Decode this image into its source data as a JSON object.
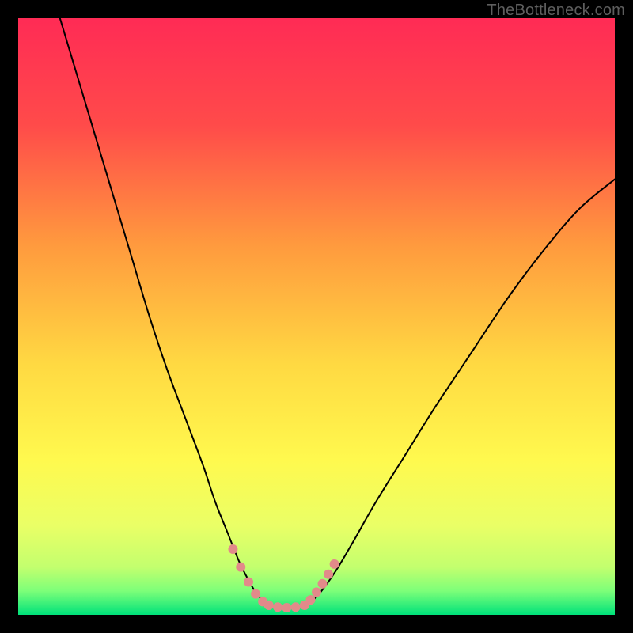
{
  "watermark": "TheBottleneck.com",
  "chart_data": {
    "type": "line",
    "title": "",
    "xlabel": "",
    "ylabel": "",
    "xlim": [
      0,
      100
    ],
    "ylim": [
      0,
      100
    ],
    "background_gradient": {
      "top": "#ff2b55",
      "mid_upper": "#ff7a3a",
      "mid": "#ffe346",
      "mid_lower": "#e8ff6a",
      "bottom": "#00e878"
    },
    "series": [
      {
        "name": "left-curve",
        "x": [
          7,
          10,
          13,
          16,
          19,
          22,
          25,
          28,
          31,
          33,
          35,
          37,
          38.5,
          40,
          42
        ],
        "y": [
          100,
          90,
          80,
          70,
          60,
          50,
          41,
          33,
          25,
          19,
          14,
          9,
          6,
          3.5,
          1.5
        ],
        "color": "#000000",
        "width": 2
      },
      {
        "name": "right-curve",
        "x": [
          48,
          50,
          53,
          56,
          60,
          65,
          70,
          76,
          82,
          88,
          94,
          100
        ],
        "y": [
          1.5,
          3,
          7,
          12,
          19,
          27,
          35,
          44,
          53,
          61,
          68,
          73
        ],
        "color": "#000000",
        "width": 2
      },
      {
        "name": "floor-segment",
        "x": [
          42,
          44,
          46,
          48
        ],
        "y": [
          1.5,
          1.2,
          1.2,
          1.5
        ],
        "color": "#000000",
        "width": 2
      },
      {
        "name": "highlight-left",
        "x": [
          36,
          37.3,
          38.6,
          39.8,
          41,
          42
        ],
        "y": [
          11,
          8,
          5.5,
          3.5,
          2.2,
          1.6
        ],
        "color": "#e28a8a",
        "style": "dotted-thick"
      },
      {
        "name": "highlight-floor",
        "x": [
          42,
          43.5,
          45,
          46.5,
          48
        ],
        "y": [
          1.6,
          1.3,
          1.2,
          1.3,
          1.6
        ],
        "color": "#e28a8a",
        "style": "dotted-thick"
      },
      {
        "name": "highlight-right",
        "x": [
          48,
          49,
          50,
          51,
          52,
          53
        ],
        "y": [
          1.6,
          2.5,
          3.8,
          5.2,
          6.8,
          8.5
        ],
        "color": "#e28a8a",
        "style": "dotted-thick"
      }
    ],
    "marker_radius": 6
  }
}
